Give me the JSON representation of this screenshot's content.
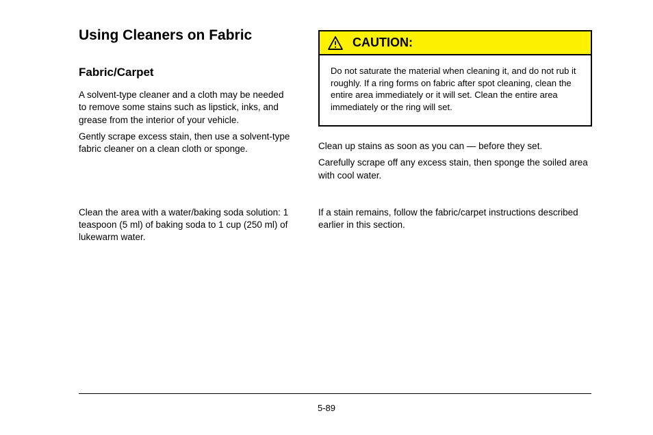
{
  "headings": {
    "main": "Using Cleaners on Fabric",
    "sub": "Fabric/Carpet"
  },
  "left": {
    "p1": "A solvent-type cleaner and a cloth may be needed to remove some stains such as lipstick, inks, and grease from the interior of your vehicle.",
    "p2": "Gently scrape excess stain, then use a solvent-type fabric cleaner on a clean cloth or sponge."
  },
  "caution": {
    "title": "CAUTION:",
    "body": "Do not saturate the material when cleaning it, and do not rub it roughly. If a ring forms on fabric after spot cleaning, clean the entire area immediately or it will set. Clean the entire area immediately or the ring will set."
  },
  "right_below": {
    "p1": "Clean up stains as soon as you can — before they set.",
    "p2": "Carefully scrape off any excess stain, then sponge the soiled area with cool water."
  },
  "bottom_left": "Clean the area with a water/baking soda solution: 1 teaspoon (5 ml) of baking soda to 1 cup (250 ml) of lukewarm water.",
  "bottom_right": "If a stain remains, follow the fabric/carpet instructions described earlier in this section.",
  "page_number": "5-89"
}
